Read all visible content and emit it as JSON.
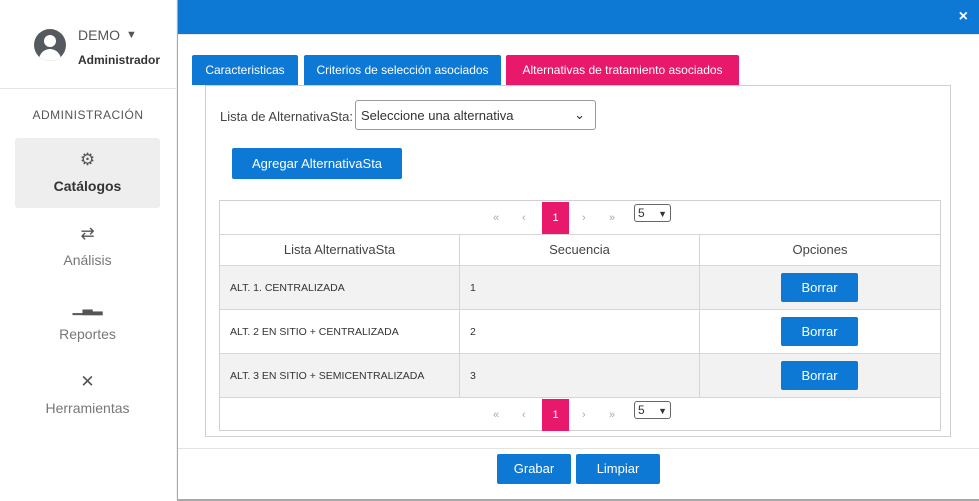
{
  "sidebar": {
    "user_name": "DEMO",
    "user_role": "Administrador",
    "section_title": "ADMINISTRACIÓN",
    "items": [
      {
        "label": "Catálogos",
        "icon": "gears-icon"
      },
      {
        "label": "Análisis",
        "icon": "swap-arrows-icon"
      },
      {
        "label": "Reportes",
        "icon": "bar-chart-icon"
      },
      {
        "label": "Herramientas",
        "icon": "tools-icon"
      }
    ]
  },
  "modal": {
    "close_label": "×",
    "tabs": [
      {
        "label": "Caracteristicas"
      },
      {
        "label": "Criterios de selección asociados"
      },
      {
        "label": "Alternativas de tratamiento asociados"
      }
    ],
    "active_tab": 2,
    "select_label": "Lista de AlternativaSta:",
    "select_value": "Seleccione una alternativa",
    "add_button": "Agregar AlternativaSta",
    "pager": {
      "first": "«",
      "prev": "‹",
      "current_page": "1",
      "next": "›",
      "last": "»",
      "page_size": "5"
    },
    "table": {
      "headers": [
        "Lista AlternativaSta",
        "Secuencia",
        "Opciones"
      ],
      "rows": [
        {
          "name": "ALT. 1. CENTRALIZADA",
          "seq": "1",
          "action": "Borrar"
        },
        {
          "name": "ALT. 2 EN SITIO + CENTRALIZADA",
          "seq": "2",
          "action": "Borrar"
        },
        {
          "name": "ALT. 3 EN SITIO + SEMICENTRALIZADA",
          "seq": "3",
          "action": "Borrar"
        }
      ]
    },
    "footer": {
      "save": "Grabar",
      "clear": "Limpiar"
    }
  },
  "colors": {
    "primary": "#0d79d5",
    "accent": "#e8196a"
  }
}
